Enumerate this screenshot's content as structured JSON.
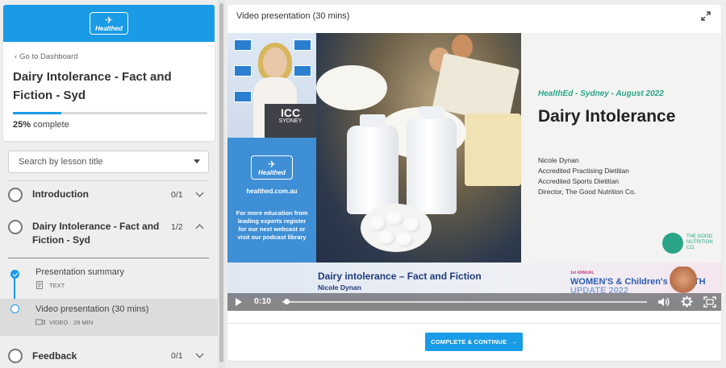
{
  "brand": {
    "logo_text": "Healthed",
    "accent_color": "#1a9be6"
  },
  "sidebar": {
    "back_link": "Go to Dashboard",
    "course_title": "Dairy Intolerance - Fact and Fiction - Syd",
    "progress": {
      "percent_label": "25%",
      "suffix": "complete",
      "fraction": 0.25
    },
    "search": {
      "label": "Search by lesson title"
    },
    "lessons": [
      {
        "title": "Introduction",
        "count": "0/1",
        "expanded": false
      },
      {
        "title": "Dairy Intolerance - Fact and Fiction - Syd",
        "count": "1/2",
        "expanded": true,
        "items": [
          {
            "title": "Presentation summary",
            "type": "TEXT",
            "completed": true,
            "active": false
          },
          {
            "title": "Video presentation (30 mins)",
            "type": "VIDEO · 29 MIN",
            "completed": false,
            "active": true
          }
        ]
      },
      {
        "title": "Feedback",
        "count": "0/1",
        "expanded": false
      }
    ]
  },
  "main": {
    "title": "Video presentation (30 mins)",
    "video": {
      "current_time": "0:10",
      "progress_fraction": 0.005,
      "speaker_panel": {
        "podium_logo": "ICC",
        "podium_city": "SYDNEY"
      },
      "promo": {
        "logo_text": "Healthed",
        "site": "healthed.com.au",
        "text": "For more education from leading experts register for our next webcast or visit our podcast library"
      },
      "slide": {
        "event": "HealthEd -  Sydney  - August 2022",
        "title": "Dairy Intolerance",
        "speaker_lines": [
          "Nicole Dynan",
          "Accredited Practising Dietitian",
          "Accredited Sports Dietitian",
          "Director, The Good Nutrition Co."
        ],
        "org_logo_text": "THE GOOD NUTRITION CO."
      },
      "banner": {
        "title": "Dairy intolerance – Fact and Fiction",
        "speaker": "Nicole Dynan",
        "event_small": "1st ANNUAL",
        "event_line1": "WOMEN'S & Children's HEALTH",
        "event_line2": "UPDATE 2022"
      }
    },
    "complete_button": "COMPLETE & CONTINUE"
  }
}
